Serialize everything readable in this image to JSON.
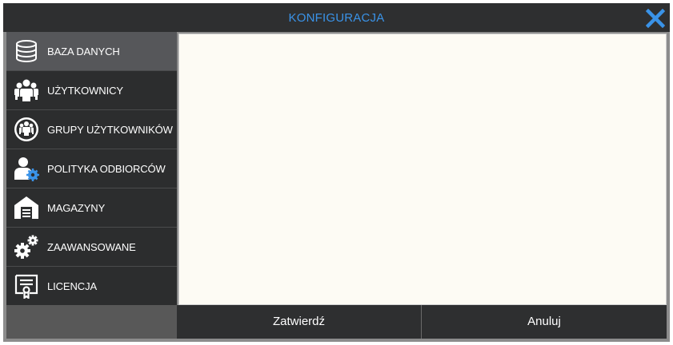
{
  "dialog": {
    "title": "KONFIGURACJA",
    "close_icon": "close-icon",
    "accent_color": "#3a93e8"
  },
  "sidebar": {
    "items": [
      {
        "label": "BAZA DANYCH",
        "icon": "database-icon",
        "active": true
      },
      {
        "label": "UŻYTKOWNICY",
        "icon": "users-icon",
        "active": false
      },
      {
        "label": "GRUPY UŻYTKOWNIKÓW",
        "icon": "user-groups-icon",
        "active": false
      },
      {
        "label": "POLITYKA ODBIORCÓW",
        "icon": "user-settings-icon",
        "active": false
      },
      {
        "label": "MAGAZYNY",
        "icon": "warehouse-icon",
        "active": false
      },
      {
        "label": "ZAAWANSOWANE",
        "icon": "gears-icon",
        "active": false
      },
      {
        "label": "LICENCJA",
        "icon": "certificate-icon",
        "active": false
      }
    ]
  },
  "footer": {
    "confirm_label": "Zatwierdź",
    "cancel_label": "Anuluj"
  }
}
